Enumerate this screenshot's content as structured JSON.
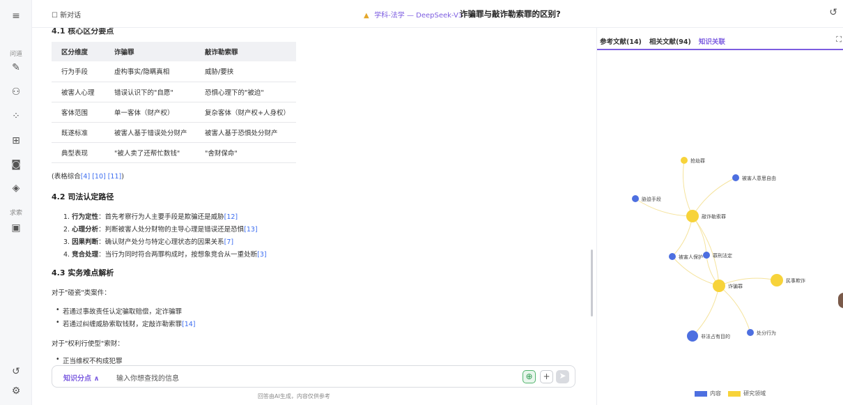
{
  "sidebar": {
    "menu_icon": "hamburger-icon",
    "ask_label": "问道",
    "search_label": "求索",
    "icons": [
      "edit-icon",
      "users-icon",
      "apps-icon",
      "book-icon",
      "scan-icon",
      "layers-icon",
      "save-icon",
      "history-icon",
      "settings-icon"
    ]
  },
  "topbar": {
    "new_chat": "新对话",
    "model": "学科-法学 — DeepSeek-V3",
    "title": "诈骗罪与敲诈勒索罪的区别?"
  },
  "article": {
    "cut_heading": "4.1 核心区分要点",
    "table": {
      "headers": [
        "区分维度",
        "诈骗罪",
        "敲诈勒索罪"
      ],
      "rows": [
        [
          "行为手段",
          "虚构事实/隐瞒真相",
          "威胁/要挟"
        ],
        [
          "被害人心理",
          "错误认识下的\"自愿\"",
          "恐惧心理下的\"被迫\""
        ],
        [
          "客体范围",
          "单一客体（财产权）",
          "复杂客体（财产权+人身权）"
        ],
        [
          "既遂标准",
          "被害人基于错误处分财产",
          "被害人基于恐惧处分财产"
        ],
        [
          "典型表现",
          "\"被人卖了还帮忙数钱\"",
          "\"舍财保命\""
        ]
      ]
    },
    "table_note": "(表格综合",
    "table_note_refs": "[4] [10] [11]",
    "table_note_end": ")",
    "h42": "4.2 司法认定路径",
    "path": [
      {
        "num": "1.",
        "bold": "行为定性",
        "text": "：首先考察行为人主要手段是欺骗还是威胁",
        "ref": "[12]"
      },
      {
        "num": "2.",
        "bold": "心理分析",
        "text": "：判断被害人处分财物的主导心理是错误还是恐惧",
        "ref": "[13]"
      },
      {
        "num": "3.",
        "bold": "因果判断",
        "text": "：确认财产处分与特定心理状态的因果关系",
        "ref": "[7]"
      },
      {
        "num": "4.",
        "bold": "竞合处理",
        "text": "：当行为同时符合两罪构成时，按想象竞合从一重处断",
        "ref": "[3]"
      }
    ],
    "h43": "4.3 实务难点解析",
    "case1_intro": "对于\"碰瓷\"类案件：",
    "case1_items": [
      {
        "text": "若通过事故责任认定骗取赔偿，定诈骗罪",
        "ref": ""
      },
      {
        "text": "若通过纠缠威胁索取钱财，定敲诈勒索罪",
        "ref": "[14]"
      }
    ],
    "case2_intro": "对于\"权利行使型\"索财：",
    "case2_items": [
      "正当维权不构成犯罪"
    ]
  },
  "input": {
    "knowledge_label": "知识分点 ∧",
    "placeholder": "输入你想查找的信息",
    "disclaimer": "回答由AI生成，内容仅供参考"
  },
  "panel": {
    "tabs": [
      "参考文献(14)",
      "相关文献(94)",
      "知识关联"
    ],
    "active_tab": 2,
    "nodes": [
      {
        "label": "抢劫罪",
        "type": "field"
      },
      {
        "label": "被害人意思自由",
        "type": "content"
      },
      {
        "label": "胁迫手段",
        "type": "content"
      },
      {
        "label": "敲诈勒索罪",
        "type": "field"
      },
      {
        "label": "被害人保护",
        "type": "content"
      },
      {
        "label": "罪刑法定",
        "type": "content"
      },
      {
        "label": "诈骗罪",
        "type": "field"
      },
      {
        "label": "民事欺诈",
        "type": "field"
      },
      {
        "label": "非法占有目的",
        "type": "content"
      },
      {
        "label": "处分行为",
        "type": "content"
      }
    ],
    "legend": [
      {
        "label": "内容",
        "color": "#4d6fe0"
      },
      {
        "label": "研究领域",
        "color": "#f7d33a"
      }
    ],
    "colors": {
      "content": "#4d6fe0",
      "field": "#f7d33a",
      "link": "#f5e39c",
      "accent": "#7c5ce0"
    }
  }
}
